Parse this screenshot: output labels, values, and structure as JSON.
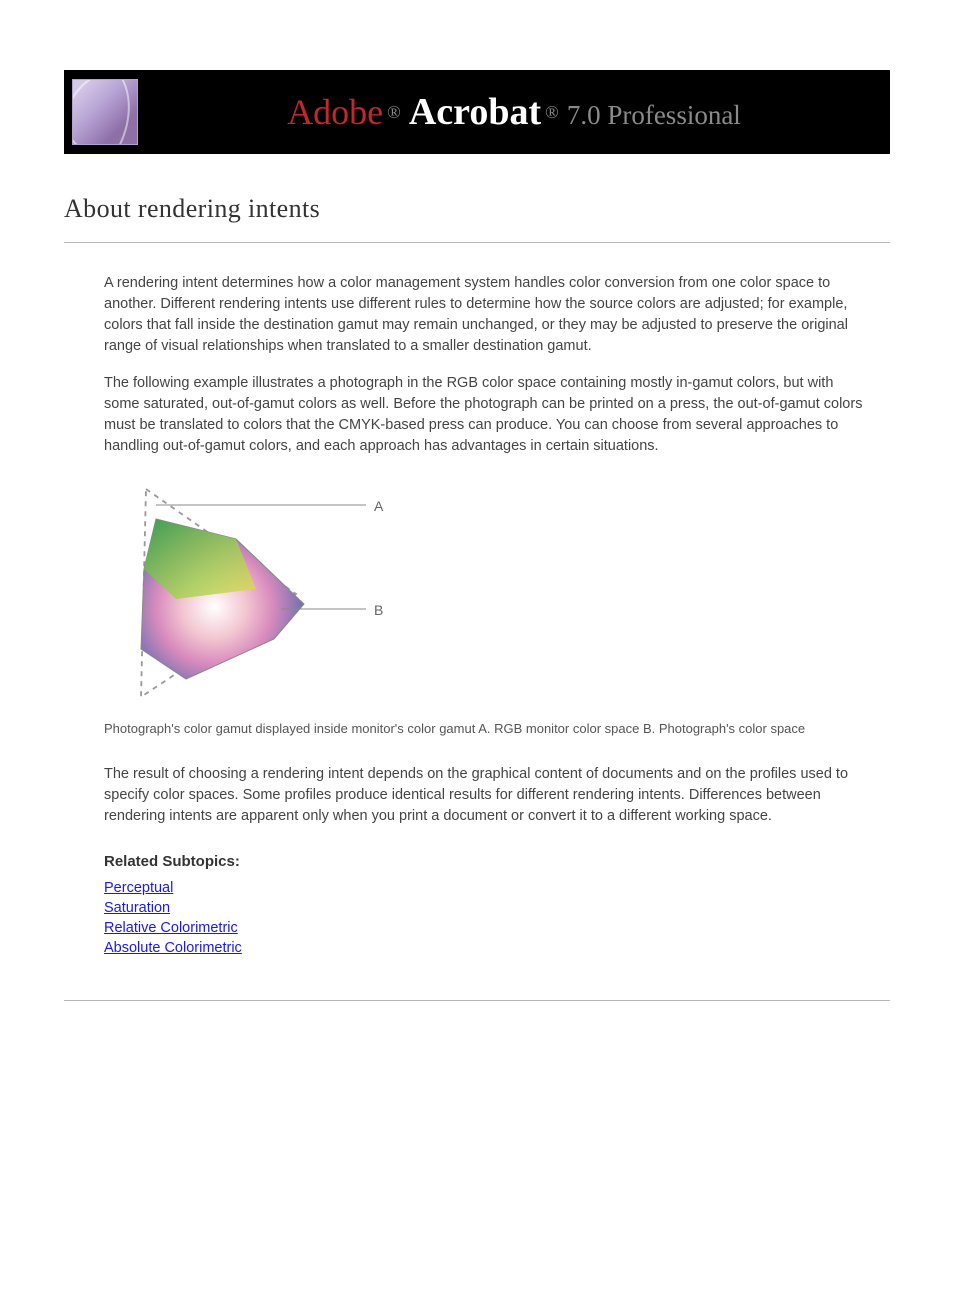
{
  "banner": {
    "adobe": "Adobe",
    "reg1": "®",
    "acrobat": "Acrobat",
    "reg2": "®",
    "suffix": "7.0 Professional",
    "logo_name": "acrobat-logo-icon"
  },
  "page_title": "About rendering intents",
  "paragraphs": [
    "A rendering intent determines how a color management system handles color conversion from one color space to another. Different rendering intents use different rules to determine how the source colors are adjusted; for example, colors that fall inside the destination gamut may remain unchanged, or they may be adjusted to preserve the original range of visual relationships when translated to a smaller destination gamut.",
    "The following example illustrates a photograph in the RGB color space containing mostly in-gamut colors, but with some saturated, out-of-gamut colors as well. Before the photograph can be printed on a press, the out-of-gamut colors must be translated to colors that the CMYK-based press can produce. You can choose from several approaches to handling out-of-gamut colors, and each approach has advantages in certain situations."
  ],
  "diagram": {
    "label_a": "A",
    "label_b": "B"
  },
  "caption": "Photograph's color gamut displayed inside monitor's color gamut A. RGB monitor color space B. Photograph's color space",
  "closing_paragraph": "The result of choosing a rendering intent depends on the graphical content of documents and on the profiles used to specify color spaces. Some profiles produce identical results for different rendering intents. Differences between rendering intents are apparent only when you print a document or convert it to a different working space.",
  "subtopics": {
    "heading": "Related Subtopics:",
    "links": [
      "Perceptual",
      "Saturation",
      "Relative Colorimetric",
      "Absolute Colorimetric"
    ]
  }
}
